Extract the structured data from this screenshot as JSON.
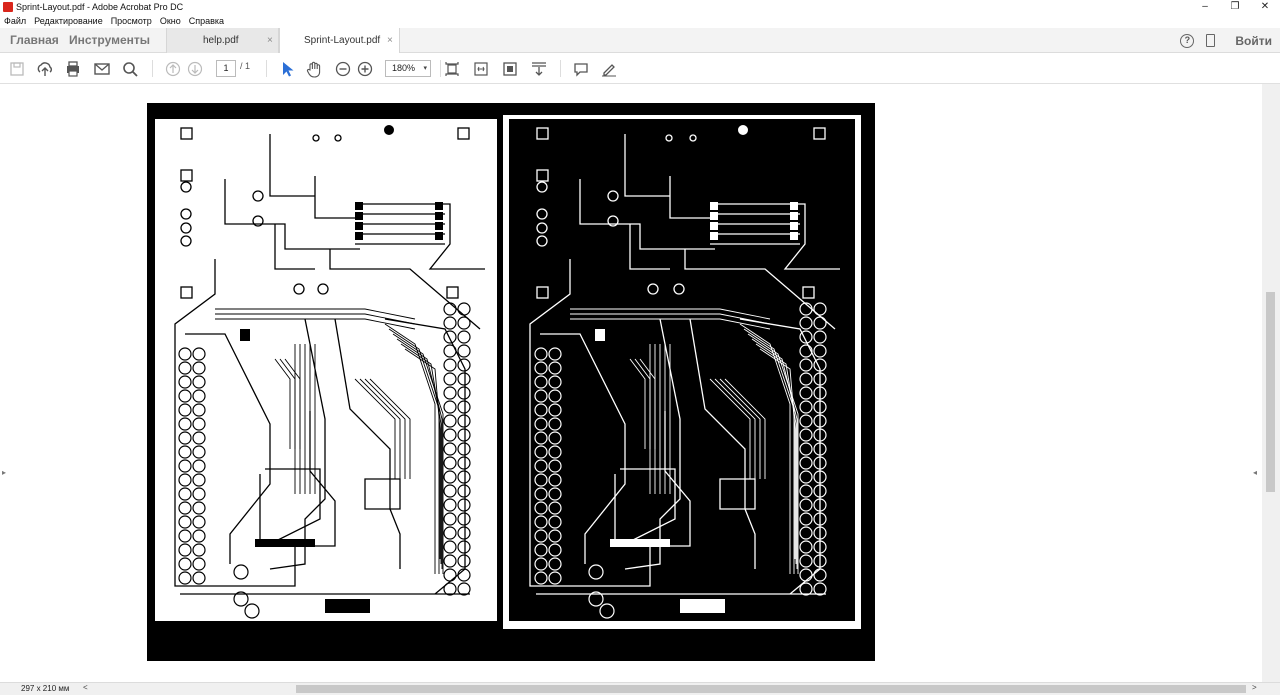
{
  "window": {
    "title": "Sprint-Layout.pdf - Adobe Acrobat Pro DC",
    "controls": [
      "–",
      "❐",
      "✕"
    ]
  },
  "menu": {
    "items": [
      "Файл",
      "Редактирование",
      "Просмотр",
      "Окно",
      "Справка"
    ]
  },
  "tabs": {
    "home": "Главная",
    "tools": "Инструменты",
    "documents": [
      {
        "label": "help.pdf",
        "active": false
      },
      {
        "label": "Sprint-Layout.pdf",
        "active": true
      }
    ],
    "close_glyph": "×",
    "help_glyph": "?",
    "signin": "Войти"
  },
  "toolbar": {
    "page_current": "1",
    "page_total": "/ 1",
    "zoom": "180%",
    "zoom_caret": "▾",
    "icons": [
      "save-icon",
      "upload-icon",
      "print-icon",
      "email-icon",
      "search-icon",
      "page-up-icon",
      "page-down-icon",
      "select-arrow-icon",
      "hand-tool-icon",
      "zoom-out-icon",
      "zoom-in-icon",
      "fit-page-icon",
      "fit-width-icon",
      "fullscreen-icon",
      "scroll-mode-icon",
      "comment-icon",
      "sign-icon"
    ]
  },
  "status": {
    "page_size": "297 x 210 мм",
    "left_arrow": "<",
    "right_arrow": ">"
  },
  "colors": {
    "accent_blue": "#2b6fd6",
    "title_icon_red": "#d9261c",
    "board_black": "#000000",
    "board_white": "#ffffff"
  }
}
